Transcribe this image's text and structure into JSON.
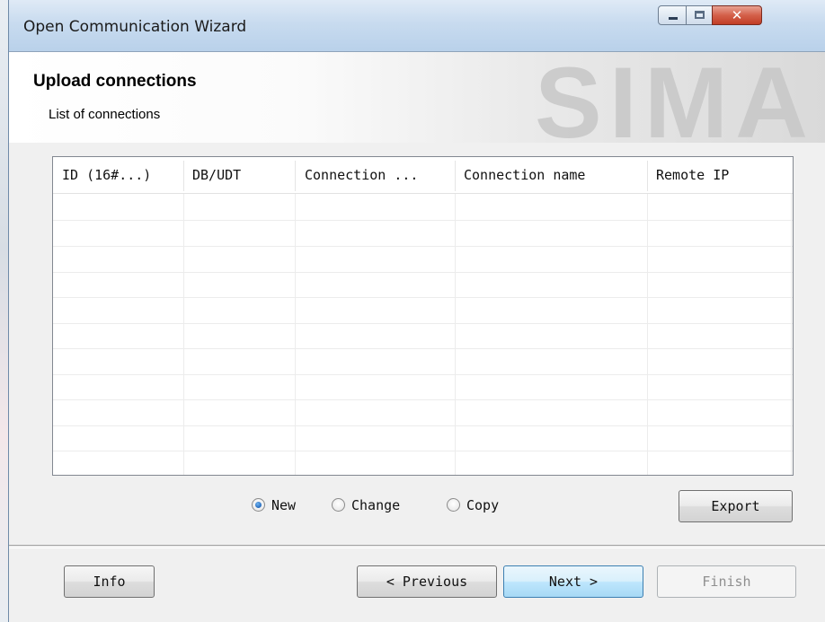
{
  "window": {
    "title": "Open Communication Wizard"
  },
  "header": {
    "title": "Upload connections",
    "subtitle": "List of connections",
    "watermark": "SIMA"
  },
  "table": {
    "columns": [
      "ID (16#...)",
      "DB/UDT",
      "Connection ...",
      "Connection name",
      "Remote IP"
    ],
    "rows": []
  },
  "options": {
    "new_label": "New",
    "change_label": "Change",
    "copy_label": "Copy",
    "selected": "New"
  },
  "buttons": {
    "export": "Export",
    "info": "Info",
    "previous": "< Previous",
    "next": "Next >",
    "finish": "Finish"
  }
}
